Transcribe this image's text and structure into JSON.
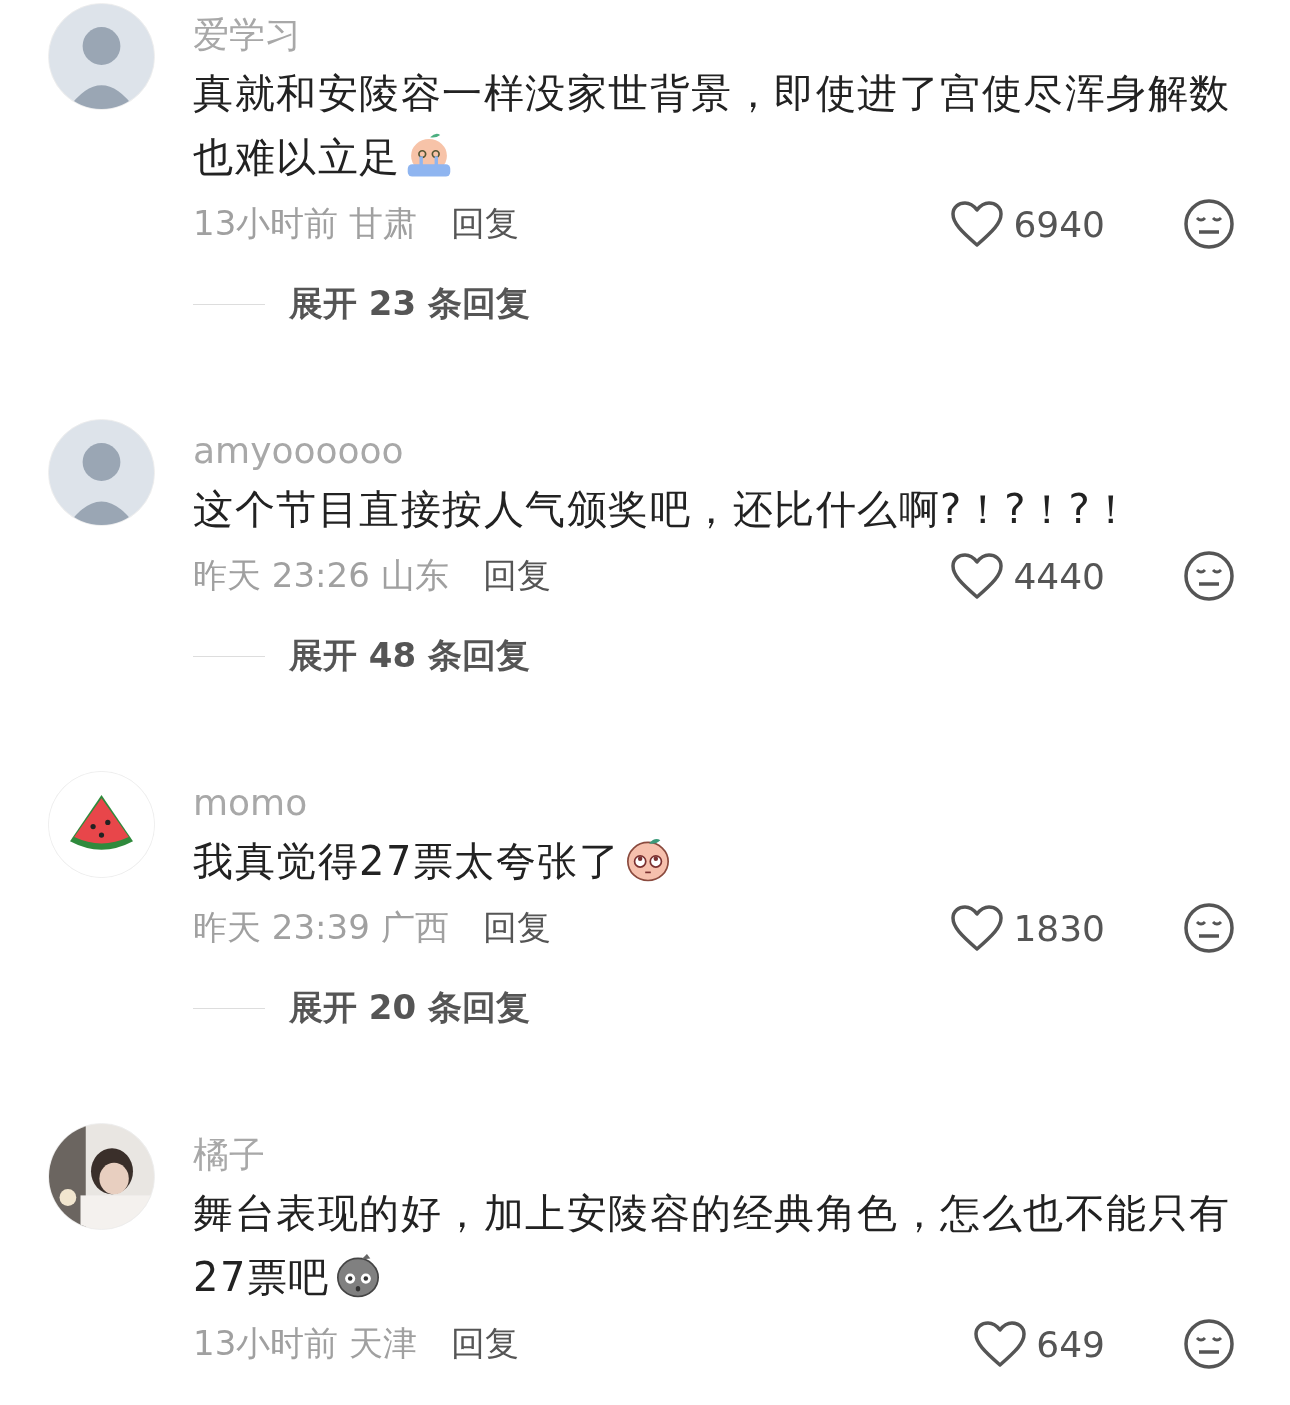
{
  "comments": [
    {
      "avatar": {
        "kind": "figure"
      },
      "username": "爱学习",
      "text": "真就和安陵容一样没家世背景，即使进了宫使尽浑身解数也难以立足",
      "emoji": {
        "kind": "crying"
      },
      "time": "13小时前",
      "location": "甘肃",
      "reply": "回复",
      "likes": "6940",
      "expand": {
        "label": "展开",
        "count": "23",
        "suffix": "条回复"
      }
    },
    {
      "avatar": {
        "kind": "figure"
      },
      "username": "amyoooooo",
      "text": "这个节目直接按人气颁奖吧，还比什么啊?！?！?！",
      "time": "昨天 23:26",
      "location": "山东",
      "reply": "回复",
      "likes": "4440",
      "expand": {
        "label": "展开",
        "count": "48",
        "suffix": "条回复"
      }
    },
    {
      "avatar": {
        "kind": "watermelon"
      },
      "username": "momo",
      "text": "我真觉得27票太夸张了",
      "emoji": {
        "kind": "eyes-up"
      },
      "time": "昨天 23:39",
      "location": "广西",
      "reply": "回复",
      "likes": "1830",
      "expand": {
        "label": "展开",
        "count": "20",
        "suffix": "条回复"
      }
    },
    {
      "username": "橘子",
      "text": "舞台表现的好，加上安陵容的经典角色，怎么也不能只有27票吧",
      "emoji": {
        "kind": "shocked"
      },
      "time": "13小时前",
      "location": "天津",
      "reply": "回复",
      "likes": "649"
    }
  ]
}
